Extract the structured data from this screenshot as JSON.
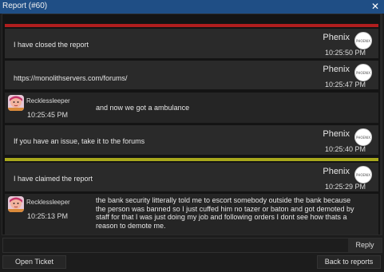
{
  "window": {
    "title": "Report (#60)",
    "close_glyph": "✕"
  },
  "colors": {
    "titlebar": "#1f4e85",
    "closed_stripe": "#b01e1e",
    "claimed_stripe": "#a8a81c"
  },
  "messages": [
    {
      "author": "Phenix",
      "avatar_text": "PHOENIX",
      "text": "I have closed the report",
      "time": "10:25:50 PM"
    },
    {
      "author": "Phenix",
      "avatar_text": "PHOENIX",
      "text": "https://monolithservers.com/forums/",
      "time": "10:25:47 PM"
    },
    {
      "author": "Recklessleeper",
      "text": "and now we got a ambulance",
      "time": "10:25:45 PM"
    },
    {
      "author": "Phenix",
      "avatar_text": "PHOENIX",
      "text": "If you have an issue, take it to the forums",
      "time": "10:25:40 PM"
    },
    {
      "author": "Phenix",
      "avatar_text": "PHOENIX",
      "text": "I have claimed the report",
      "time": "10:25:29 PM"
    },
    {
      "author": "Recklessleeper",
      "text_lines": [
        "the bank security litterally told me to escort somebody outside the bank because",
        "the person was banned so I just cuffed him no tazer or baton and got demoted by",
        "staff for that I was just doing my job and following orders I dont see how thats a",
        "reason to demote me."
      ],
      "time": "10:25:13 PM"
    }
  ],
  "reply": {
    "placeholder": "",
    "button_label": "Reply"
  },
  "footer": {
    "open_ticket": "Open Ticket",
    "back_to_reports": "Back to reports"
  }
}
